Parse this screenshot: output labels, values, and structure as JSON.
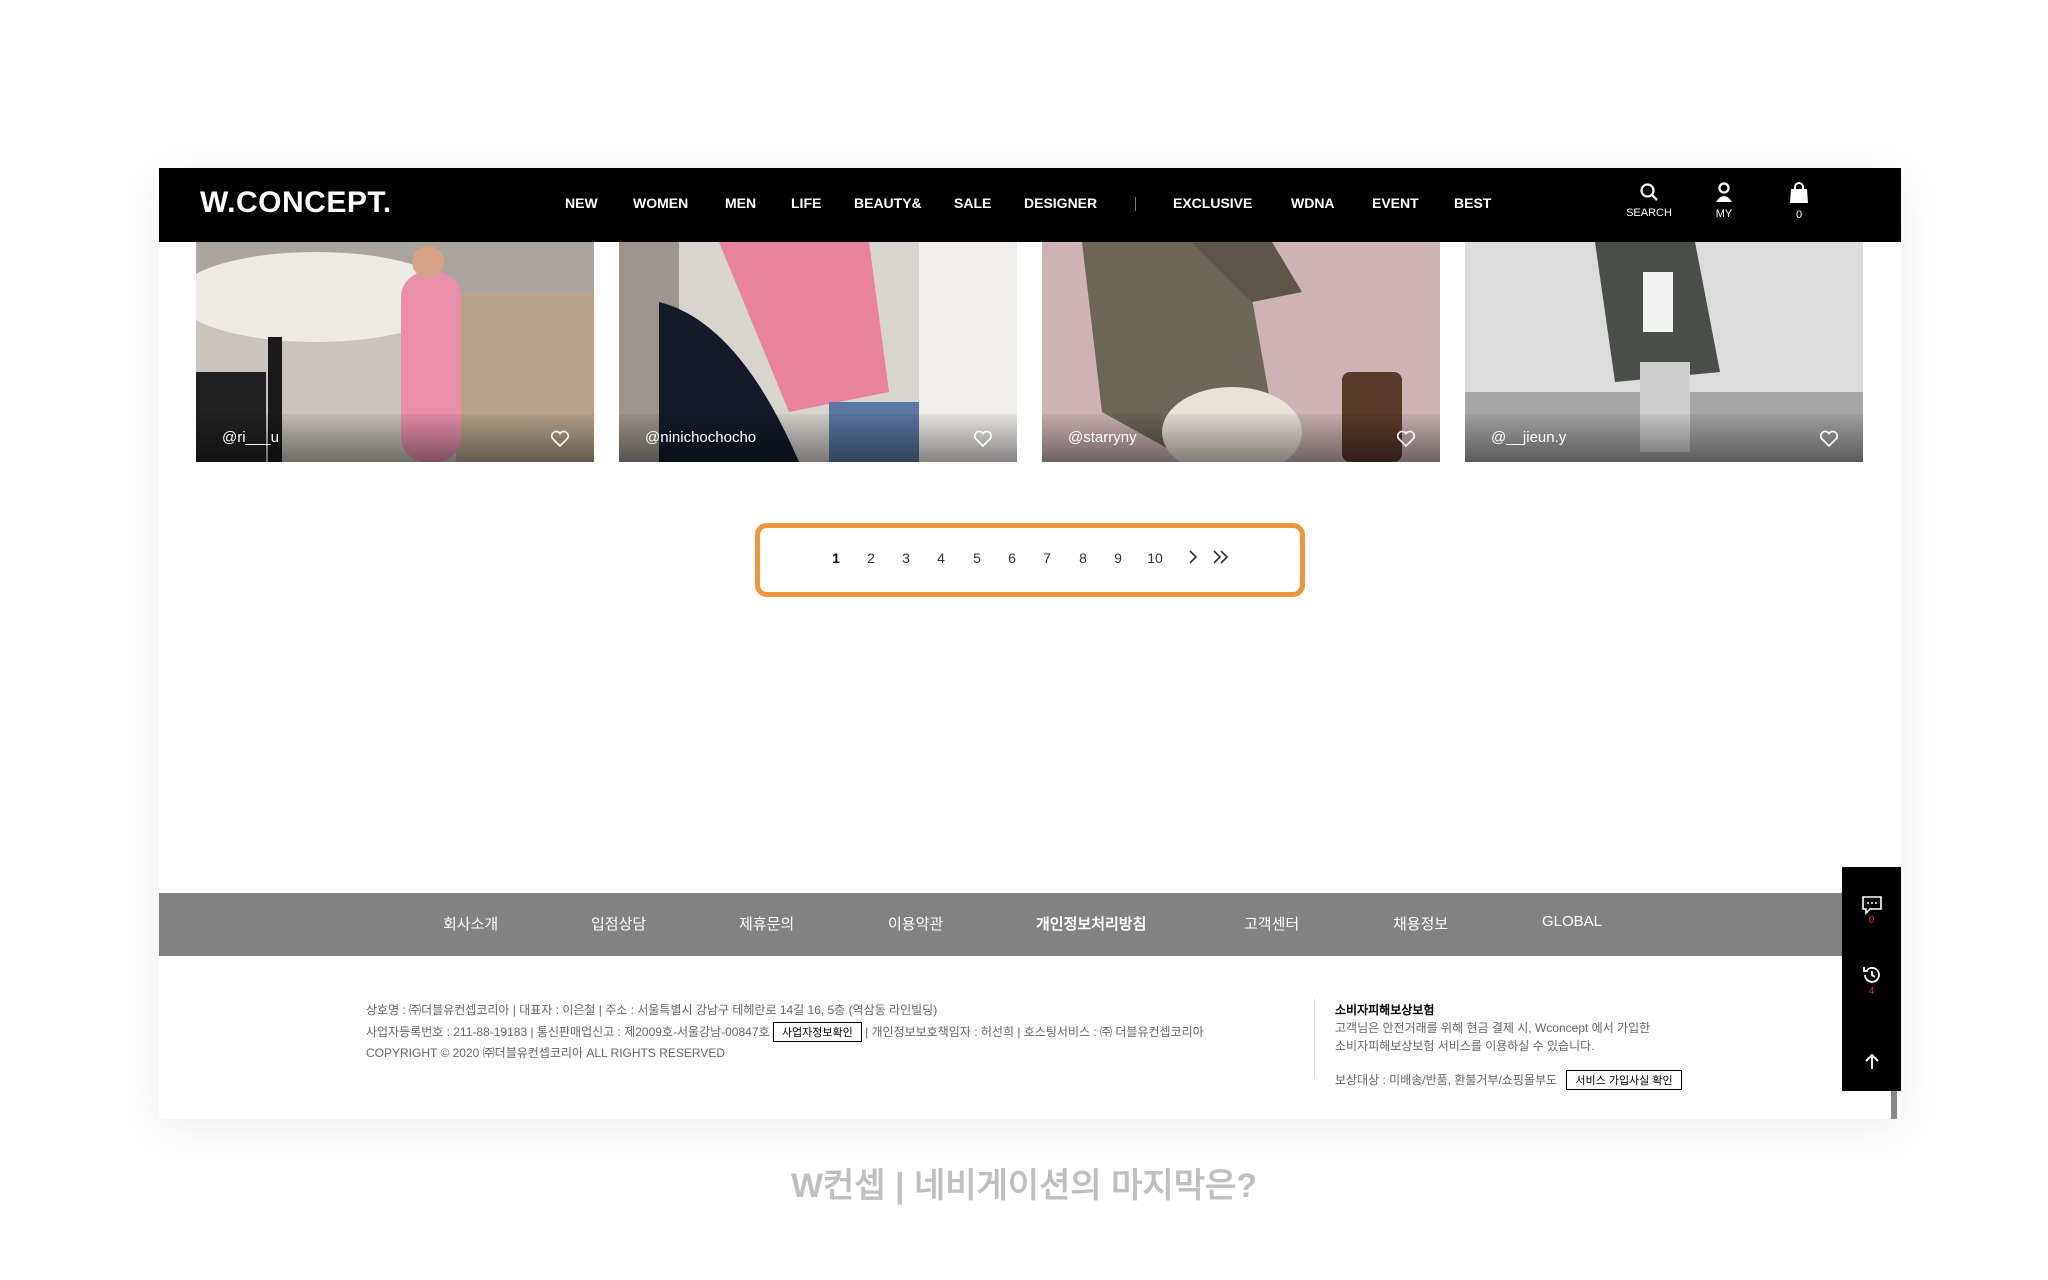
{
  "header": {
    "logo": "W.CONCEPT.",
    "nav": [
      "NEW",
      "WOMEN",
      "MEN",
      "LIFE",
      "BEAUTY&",
      "SALE",
      "DESIGNER",
      "EXCLUSIVE",
      "WDNA",
      "EVENT",
      "BEST"
    ],
    "search_label": "SEARCH",
    "my_label": "MY",
    "cart_count": "0"
  },
  "cards": [
    {
      "handle": "@ri___u"
    },
    {
      "handle": "@ninichochocho"
    },
    {
      "handle": "@starryny"
    },
    {
      "handle": "@__jieun.y"
    }
  ],
  "pagination": {
    "pages": [
      "1",
      "2",
      "3",
      "4",
      "5",
      "6",
      "7",
      "8",
      "9",
      "10"
    ],
    "current": "1"
  },
  "footer": {
    "links": [
      "회사소개",
      "입점상담",
      "제휴문의",
      "이용약관",
      "개인정보처리방침",
      "고객센터",
      "채용정보",
      "GLOBAL"
    ],
    "company_line1": "상호명 : ㈜더블유컨셉코리아  |  대표자 : 이은철  |  주소 : 서울특별시 강남구 테헤란로 14길 16, 5층 (역삼동 라인빌딩)",
    "company_line2_a": "사업자등록번호 : 211-88-19183  |  통신판매업신고 : 제2009호-서울강남-00847호",
    "biz_button": "사업자정보확인",
    "company_line2_b": "|  개인정보보호책임자 : 허선희  |  호스팅서비스 : ㈜ 더블유컨셉코리아",
    "copyright": "COPYRIGHT © 2020 ㈜더블유컨셉코리아 ALL RIGHTS RESERVED",
    "insurance_title": "소비자피해보상보험",
    "insurance_text1": "고객님은 안전거래를 위해 현금 결제 시, Wconcept 에서 가입한",
    "insurance_text2": "소비자피해보상보험 서비스를 이용하실 수 있습니다.",
    "insurance_target": "보상대상 : 미배송/반품, 환불거부/쇼핑몰부도",
    "service_button": "서비스 가입사실 확인"
  },
  "side": {
    "chat_count": "0",
    "recent_count": "4"
  },
  "caption": "W컨셉 | 네비게이션의 마지막은?",
  "colors": {
    "highlight": "#f0943d",
    "header_bg": "#000000",
    "footer_bar": "#828282",
    "badge": "#e02a2a"
  },
  "icons": [
    "search-icon",
    "user-icon",
    "cart-icon",
    "heart-icon",
    "chevron-right-icon",
    "double-chevron-right-icon",
    "chat-icon",
    "history-icon",
    "arrow-up-icon"
  ]
}
